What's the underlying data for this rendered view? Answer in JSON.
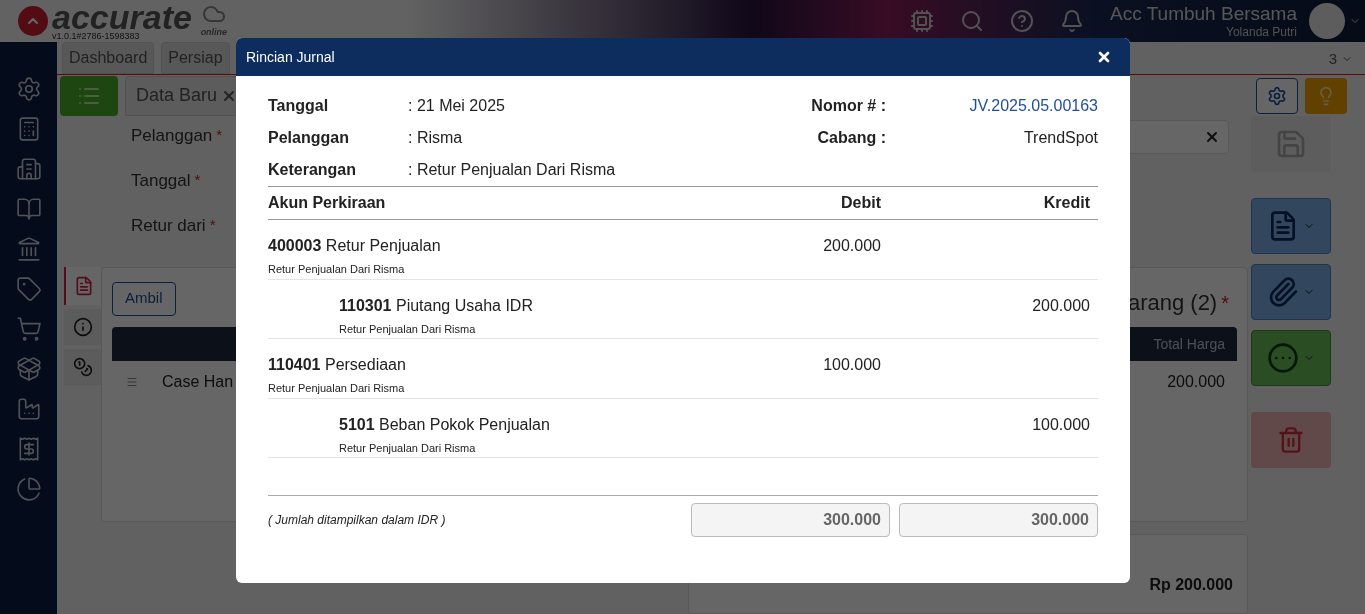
{
  "header": {
    "logo_text": "accurate",
    "logo_sub": "online",
    "version": "v1.0.1#2786-1598383",
    "company": "Acc Tumbuh Bersama",
    "user": "Yolanda Putri"
  },
  "tabs": [
    {
      "label": "Dashboard",
      "selected": false
    },
    {
      "label": "Persiap",
      "selected": false
    }
  ],
  "tab_count": "3",
  "doc_tab": {
    "label": "Data Baru"
  },
  "form": {
    "fields": [
      {
        "label": "Pelanggan",
        "mark": "*"
      },
      {
        "label": "Tanggal",
        "mark": "*"
      },
      {
        "label": "Retur dari",
        "mark": "*"
      }
    ]
  },
  "panel": {
    "button": "Ambil",
    "title": "arang (2)",
    "title_mark": "*",
    "column": "Total Harga",
    "rows": [
      {
        "item": "Case Han",
        "total": "200.000"
      }
    ]
  },
  "summary": {
    "total": "Rp 200.000"
  },
  "modal": {
    "title": "Rincian Jurnal",
    "info_left": [
      {
        "label": "Tanggal",
        "value": ": 21 Mei 2025"
      },
      {
        "label": "Pelanggan",
        "value": ": Risma"
      },
      {
        "label": "Keterangan",
        "value": ": Retur Penjualan Dari Risma"
      }
    ],
    "info_right": [
      {
        "label": "Nomor # :",
        "value": "JV.2025.05.00163",
        "kind": "link"
      },
      {
        "label": "Cabang :",
        "value": "TrendSpot",
        "kind": "text"
      }
    ],
    "columns": [
      "Akun Perkiraan",
      "Debit",
      "Kredit"
    ],
    "rows": [
      {
        "kind": "debit",
        "code": "400003",
        "name": "Retur Penjualan",
        "note": "Retur Penjualan Dari Risma",
        "amount": "200.000"
      },
      {
        "kind": "credit",
        "code": "110301",
        "name": "Piutang Usaha IDR",
        "note": "Retur Penjualan Dari Risma",
        "amount": "200.000"
      },
      {
        "kind": "debit",
        "code": "110401",
        "name": "Persediaan",
        "note": "Retur Penjualan Dari Risma",
        "amount": "100.000"
      },
      {
        "kind": "credit",
        "code": "5101",
        "name": "Beban Pokok Penjualan",
        "note": "Retur Penjualan Dari Risma",
        "amount": "100.000"
      }
    ],
    "footnote": "( Jumlah ditampilkan dalam IDR )",
    "total_debit": "300.000",
    "total_credit": "300.000"
  }
}
